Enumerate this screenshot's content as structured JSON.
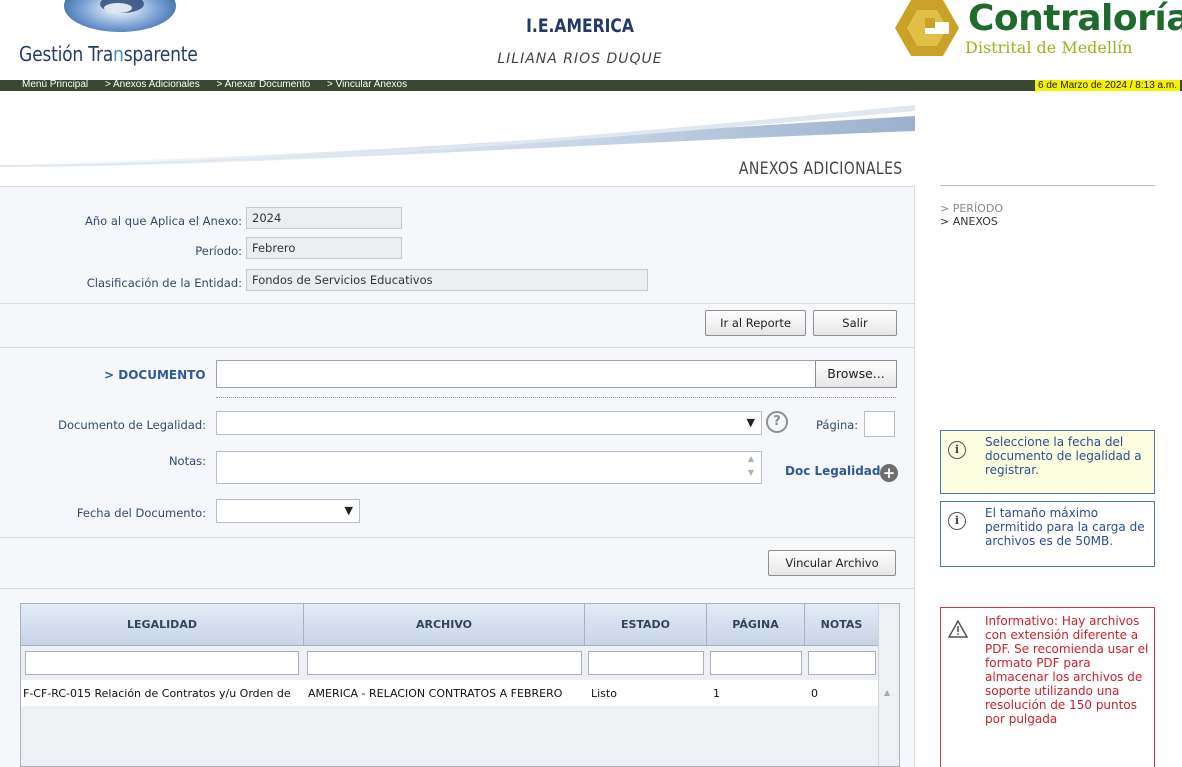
{
  "header": {
    "logo_text_a": "Gestión Tra",
    "logo_text_b": "n",
    "logo_text_c": "sparente",
    "school_name": "I.E.AMERICA",
    "person_name": "LILIANA RIOS DUQUE",
    "contraloria_title": "Contraloría",
    "contraloria_subtitle": "Distrital de Medellín"
  },
  "nav": {
    "breadcrumb": [
      "Menú Principal",
      "> Anexos Adicionales",
      "> Anexar Documento",
      "> Vincular Anexos"
    ],
    "date": "6 de Marzo de 2024 / 8:13 a.m."
  },
  "panel": {
    "title": "ANEXOS ADICIONALES",
    "anio_label": "Año al que Aplica el Anexo:",
    "anio_value": "2024",
    "periodo_label": "Período:",
    "periodo_value": "Febrero",
    "clasificacion_label": "Clasificación de la Entidad:",
    "clasificacion_value": "Fondos de Servicios Educativos",
    "ir_reporte_button": "Ir al Reporte",
    "salir_button": "Salir",
    "documento_label": "> DOCUMENTO",
    "browse_button": "Browse...",
    "doc_legalidad_label": "Documento de Legalidad:",
    "help_glyph": "?",
    "pagina_label": "Página:",
    "notas_label": "Notas:",
    "doc_legalidad_link": "Doc Legalidad",
    "fecha_label": "Fecha del Documento:",
    "vincular_button": "Vincular Archivo"
  },
  "table": {
    "columns": [
      "LEGALIDAD",
      "ARCHIVO",
      "ESTADO",
      "PÁGINA",
      "NOTAS"
    ],
    "rows": [
      {
        "legalidad": "F-CF-RC-015 Relación de Contratos y/u Orden de",
        "archivo": "AMERICA - RELACION CONTRATOS A FEBRERO",
        "estado": "Listo",
        "pagina": "1",
        "notas": "0"
      }
    ]
  },
  "sidebar": {
    "items": [
      "> PERÍODO",
      "> ANEXOS"
    ],
    "notice_1": "Seleccione la fecha del documento de legalidad a registrar.",
    "notice_2": "El tamaño máximo permitido para la carga de archivos es de 50MB.",
    "notice_3": "Informativo: Hay archivos con extensión diferente a PDF. Se recomienda usar el formato PDF para almacenar los archivos de soporte utilizando una resolución de 150 puntos por pulgada"
  },
  "colors": {
    "nav_bar": "#3a4733",
    "date_highlight": "#f4f200",
    "brand_green": "#1f6b2e",
    "brand_gold": "#c9a227",
    "link_blue": "#2c5a9a",
    "warning_red": "#c8222c"
  },
  "icons": [
    "swoosh-logo",
    "contraloria-emblem-icon",
    "help-icon",
    "add-circle-icon",
    "info-icon",
    "warning-icon",
    "dropdown-arrow-icon"
  ]
}
